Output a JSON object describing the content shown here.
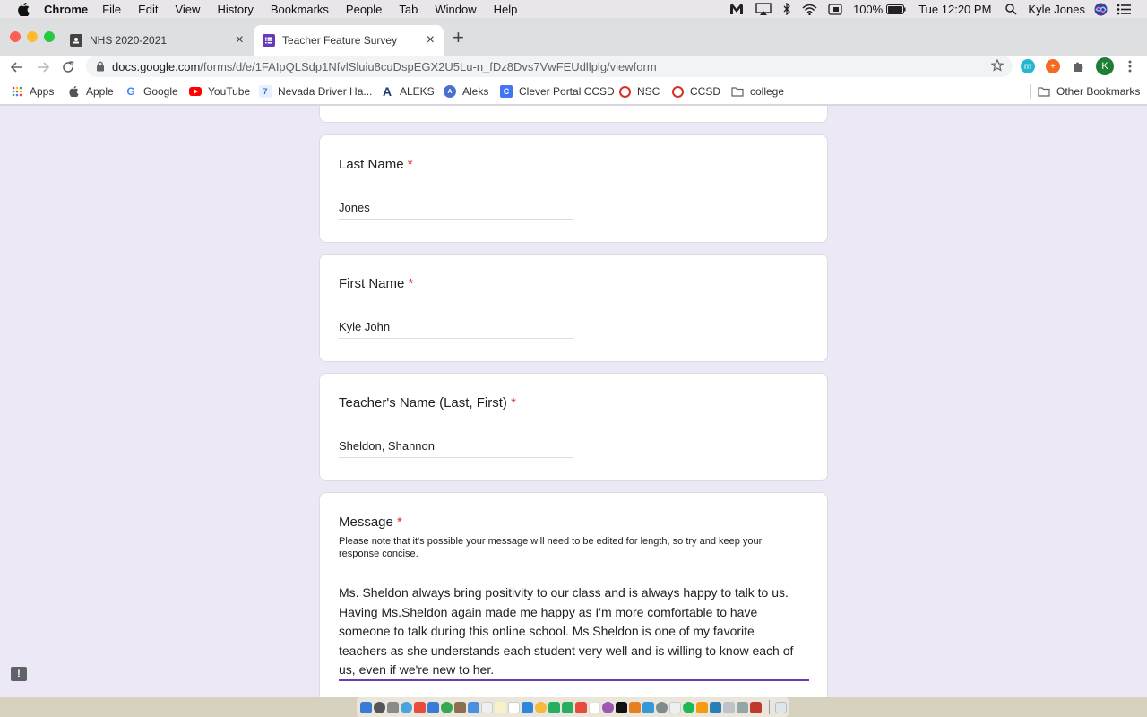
{
  "menubar": {
    "app": "Chrome",
    "items": [
      "File",
      "Edit",
      "View",
      "History",
      "Bookmarks",
      "People",
      "Tab",
      "Window",
      "Help"
    ],
    "battery": "100%",
    "clock": "Tue 12:20 PM",
    "user": "Kyle Jones"
  },
  "tabs": [
    {
      "title": "NHS 2020-2021",
      "active": false
    },
    {
      "title": "Teacher Feature Survey",
      "active": true
    }
  ],
  "omnibox": {
    "host": "docs.google.com",
    "path": "/forms/d/e/1FAIpQLSdp1NfvlSluiu8cuDspEGX2U5Lu-n_fDz8Dvs7VwFEUdllplg/viewform"
  },
  "extensions": {
    "profile_initial": "K"
  },
  "bookmarks": {
    "items": [
      "Apps",
      "Apple",
      "Google",
      "YouTube",
      "Nevada Driver Ha...",
      "ALEKS",
      "Aleks",
      "Clever Portal CCSD",
      "NSC",
      "CCSD",
      "college"
    ],
    "other": "Other Bookmarks"
  },
  "form": {
    "required_mark": "*",
    "questions": [
      {
        "title": "Last Name",
        "answer": "Jones"
      },
      {
        "title": "First Name",
        "answer": "Kyle John"
      },
      {
        "title": "Teacher's Name (Last, First)",
        "answer": "Sheldon, Shannon"
      }
    ],
    "message": {
      "title": "Message",
      "description": "Please note that it's possible your message will need to be edited for length, so try and keep your response concise.",
      "answer_lines": [
        "Ms. Sheldon always bring positivity to our class and is always happy to talk to us.",
        "Having Ms.Sheldon again made me happy as I'm more comfortable to have",
        "someone to talk during this online school. Ms.Sheldon is one of my favorite",
        "teachers as she understands each student very well and is willing to know each of",
        "us, even if we're new to her."
      ]
    }
  },
  "feedback_icon": "!",
  "icons": {
    "apple_menu": "apple-logo-icon",
    "wifi": "wifi-icon",
    "bluetooth": "bluetooth-icon",
    "search": "spotlight-search-icon",
    "back": "back-arrow-icon",
    "forward": "forward-arrow-icon",
    "reload": "reload-icon",
    "lock": "lock-icon",
    "star": "bookmark-star-icon",
    "extensions": "puzzle-icon",
    "menu": "kebab-menu-icon"
  }
}
